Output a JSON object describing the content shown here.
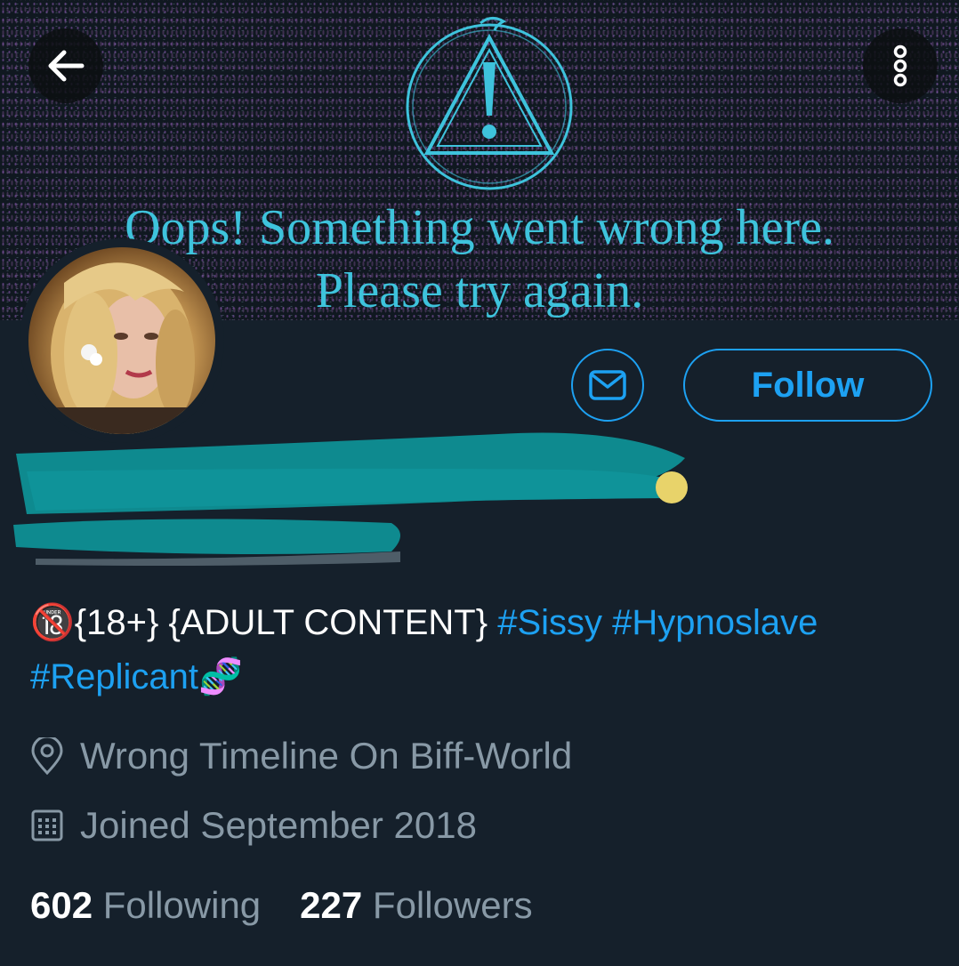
{
  "banner": {
    "line1": "Oops! Something went wrong here.",
    "line2": "Please try again."
  },
  "actions": {
    "follow_label": "Follow"
  },
  "bio": {
    "prefix": "🔞{18+} {ADULT CONTENT} ",
    "hashtags": [
      "#Sissy",
      "#Hypnoslave",
      "#Replicant"
    ],
    "suffix": "🧬"
  },
  "location": "Wrong Timeline On Biff-World",
  "joined": "Joined September 2018",
  "stats": {
    "following_count": "602",
    "following_label": "Following",
    "followers_count": "227",
    "followers_label": "Followers"
  },
  "colors": {
    "background": "#15202b",
    "accent": "#1da1f2",
    "secondary_text": "#8899a6",
    "banner_text": "#3ec3dc",
    "redaction": "#0e8a8f"
  },
  "icons": [
    "back-arrow-icon",
    "more-options-icon",
    "warning-triangle-icon",
    "mail-icon",
    "location-pin-icon",
    "calendar-icon"
  ]
}
